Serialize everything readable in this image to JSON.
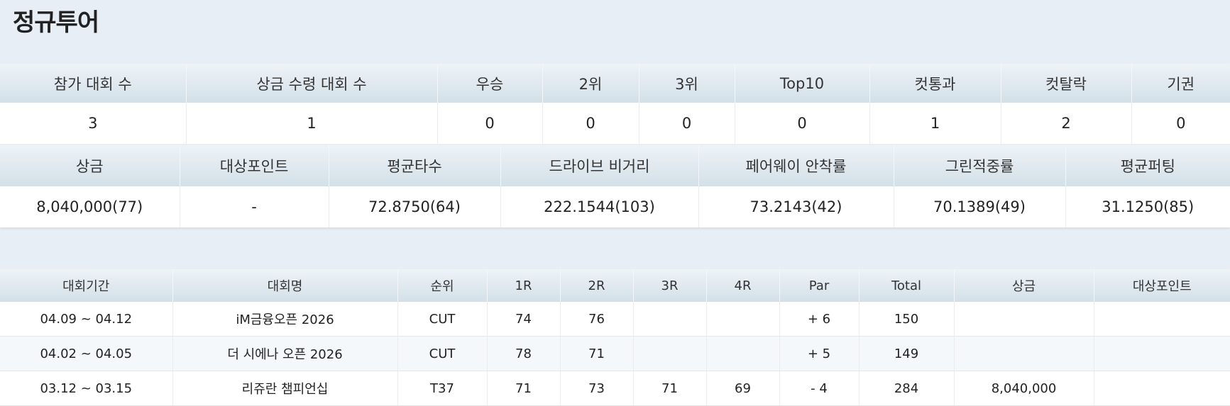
{
  "page_title": "정규투어",
  "summary1": {
    "headers": [
      "참가 대회 수",
      "상금 수령 대회 수",
      "우승",
      "2위",
      "3위",
      "Top10",
      "컷통과",
      "컷탈락",
      "기권"
    ],
    "values": [
      "3",
      "1",
      "0",
      "0",
      "0",
      "0",
      "1",
      "2",
      "0"
    ]
  },
  "summary2": {
    "headers": [
      "상금",
      "대상포인트",
      "평균타수",
      "드라이브 비거리",
      "페어웨이 안착률",
      "그린적중률",
      "평균퍼팅"
    ],
    "values": [
      "8,040,000(77)",
      "-",
      "72.8750(64)",
      "222.1544(103)",
      "73.2143(42)",
      "70.1389(49)",
      "31.1250(85)"
    ]
  },
  "results": {
    "headers": [
      "대회기간",
      "대회명",
      "순위",
      "1R",
      "2R",
      "3R",
      "4R",
      "Par",
      "Total",
      "상금",
      "대상포인트"
    ],
    "rows": [
      [
        "04.09 ~ 04.12",
        "iM금융오픈 2026",
        "CUT",
        "74",
        "76",
        "",
        "",
        "+ 6",
        "150",
        "",
        ""
      ],
      [
        "04.02 ~ 04.05",
        "더 시에나 오픈 2026",
        "CUT",
        "78",
        "71",
        "",
        "",
        "+ 5",
        "149",
        "",
        ""
      ],
      [
        "03.12 ~ 03.15",
        "리쥬란 챔피언십",
        "T37",
        "71",
        "73",
        "71",
        "69",
        "- 4",
        "284",
        "8,040,000",
        ""
      ]
    ]
  }
}
